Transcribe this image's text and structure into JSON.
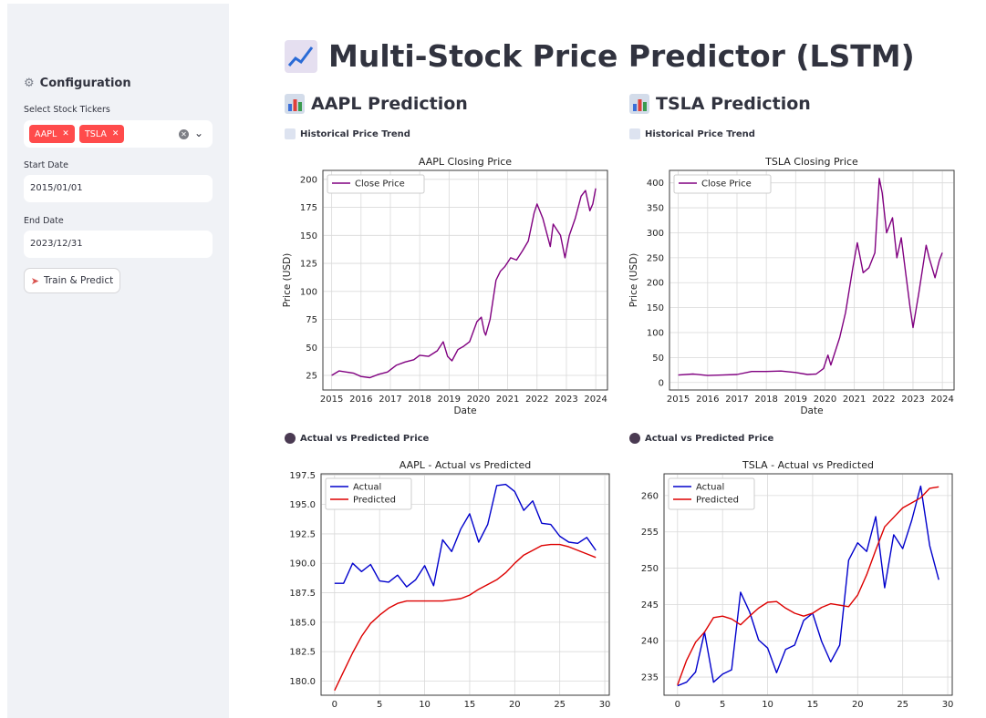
{
  "sidebar": {
    "title": "Configuration",
    "title_icon": "gear-icon",
    "tickers_label": "Select Stock Tickers",
    "tickers": [
      "AAPL",
      "TSLA"
    ],
    "start_label": "Start Date",
    "start_value": "2015/01/01",
    "end_label": "End Date",
    "end_value": "2023/12/31",
    "button_label": "Train & Predict",
    "button_icon": "rocket-icon"
  },
  "main": {
    "title": "Multi-Stock Price Predictor (LSTM)",
    "title_icon": "chart-increasing-icon",
    "columns": [
      {
        "title": "AAPL Prediction",
        "hist_label": "Historical Price Trend",
        "pred_label": "Actual vs Predicted Price"
      },
      {
        "title": "TSLA Prediction",
        "hist_label": "Historical Price Trend",
        "pred_label": "Actual vs Predicted Price"
      }
    ]
  },
  "colors": {
    "accent": "#ff4b4b",
    "sidebar_bg": "#f0f2f6",
    "close_line": "#800080",
    "actual_line": "#0000cc",
    "predicted_line": "#dd0000"
  },
  "chart_data": [
    {
      "type": "line",
      "title": "AAPL Closing Price",
      "xlabel": "Date",
      "ylabel": "Price (USD)",
      "legend": [
        "Close Price"
      ],
      "legend_position": "top-left",
      "grid": true,
      "xlim": [
        2014.7,
        2024.4
      ],
      "ylim": [
        12,
        208
      ],
      "xticks": [
        2015,
        2016,
        2017,
        2018,
        2019,
        2020,
        2021,
        2022,
        2023,
        2024
      ],
      "yticks": [
        25,
        50,
        75,
        100,
        125,
        150,
        175,
        200
      ],
      "series": [
        {
          "name": "Close Price",
          "color": "#800080",
          "x": [
            2015.0,
            2015.25,
            2015.5,
            2015.75,
            2016.0,
            2016.3,
            2016.6,
            2016.9,
            2017.2,
            2017.5,
            2017.8,
            2018.0,
            2018.3,
            2018.6,
            2018.8,
            2018.95,
            2019.1,
            2019.3,
            2019.5,
            2019.7,
            2019.95,
            2020.1,
            2020.2,
            2020.25,
            2020.4,
            2020.6,
            2020.75,
            2020.9,
            2021.1,
            2021.3,
            2021.5,
            2021.7,
            2021.9,
            2022.0,
            2022.2,
            2022.45,
            2022.55,
            2022.8,
            2022.95,
            2023.1,
            2023.3,
            2023.5,
            2023.65,
            2023.8,
            2023.9,
            2024.0
          ],
          "y": [
            25,
            29,
            28,
            27,
            24,
            23,
            26,
            28,
            34,
            37,
            39,
            43,
            42,
            47,
            55,
            42,
            38,
            48,
            51,
            55,
            73,
            77,
            64,
            61,
            75,
            110,
            118,
            122,
            130,
            128,
            136,
            145,
            170,
            178,
            165,
            140,
            160,
            150,
            130,
            150,
            165,
            185,
            190,
            172,
            178,
            192
          ]
        }
      ]
    },
    {
      "type": "line",
      "title": "TSLA Closing Price",
      "xlabel": "Date",
      "ylabel": "Price (USD)",
      "legend": [
        "Close Price"
      ],
      "legend_position": "top-left",
      "grid": true,
      "xlim": [
        2014.7,
        2024.4
      ],
      "ylim": [
        -15,
        425
      ],
      "xticks": [
        2015,
        2016,
        2017,
        2018,
        2019,
        2020,
        2021,
        2022,
        2023,
        2024
      ],
      "yticks": [
        0,
        50,
        100,
        150,
        200,
        250,
        300,
        350,
        400
      ],
      "series": [
        {
          "name": "Close Price",
          "color": "#800080",
          "x": [
            2015.0,
            2015.5,
            2016.0,
            2016.5,
            2017.0,
            2017.5,
            2018.0,
            2018.5,
            2019.0,
            2019.4,
            2019.7,
            2019.95,
            2020.1,
            2020.2,
            2020.5,
            2020.7,
            2020.95,
            2021.1,
            2021.3,
            2021.5,
            2021.7,
            2021.85,
            2021.95,
            2022.1,
            2022.3,
            2022.45,
            2022.6,
            2022.75,
            2022.9,
            2023.0,
            2023.2,
            2023.45,
            2023.55,
            2023.75,
            2023.9,
            2024.0
          ],
          "y": [
            15,
            17,
            14,
            15,
            16,
            22,
            22,
            23,
            20,
            16,
            17,
            28,
            55,
            35,
            90,
            140,
            230,
            280,
            220,
            230,
            260,
            409,
            380,
            300,
            330,
            250,
            290,
            220,
            150,
            110,
            180,
            275,
            250,
            210,
            245,
            260
          ]
        }
      ]
    },
    {
      "type": "line",
      "title": "AAPL - Actual vs Predicted",
      "legend": [
        "Actual",
        "Predicted"
      ],
      "legend_position": "top-left",
      "grid": true,
      "xlim": [
        -1.5,
        30.5
      ],
      "ylim": [
        178.8,
        197.6
      ],
      "xticks": [
        0,
        5,
        10,
        15,
        20,
        25,
        30
      ],
      "yticks": [
        180.0,
        182.5,
        185.0,
        187.5,
        190.0,
        192.5,
        195.0,
        197.5
      ],
      "series": [
        {
          "name": "Actual",
          "color": "#0000cc",
          "x": [
            0,
            1,
            2,
            3,
            4,
            5,
            6,
            7,
            8,
            9,
            10,
            11,
            12,
            13,
            14,
            15,
            16,
            17,
            18,
            19,
            20,
            21,
            22,
            23,
            24,
            25,
            26,
            27,
            28,
            29
          ],
          "y": [
            188.3,
            188.3,
            190.0,
            189.3,
            189.9,
            188.5,
            188.4,
            189.0,
            188.0,
            188.6,
            189.8,
            188.1,
            192.0,
            191.0,
            192.9,
            194.2,
            191.8,
            193.3,
            196.6,
            196.7,
            196.1,
            194.5,
            195.3,
            193.4,
            193.3,
            192.3,
            191.8,
            191.7,
            192.2,
            191.1
          ]
        },
        {
          "name": "Predicted",
          "color": "#dd0000",
          "x": [
            0,
            1,
            2,
            3,
            4,
            5,
            6,
            7,
            8,
            9,
            10,
            11,
            12,
            13,
            14,
            15,
            16,
            17,
            18,
            19,
            20,
            21,
            22,
            23,
            24,
            25,
            26,
            27,
            28,
            29
          ],
          "y": [
            179.2,
            180.8,
            182.4,
            183.8,
            184.9,
            185.6,
            186.2,
            186.6,
            186.8,
            186.8,
            186.8,
            186.8,
            186.8,
            186.9,
            187.0,
            187.3,
            187.8,
            188.2,
            188.6,
            189.2,
            190.0,
            190.7,
            191.1,
            191.5,
            191.6,
            191.6,
            191.4,
            191.1,
            190.8,
            190.5
          ]
        }
      ]
    },
    {
      "type": "line",
      "title": "TSLA - Actual vs Predicted",
      "legend": [
        "Actual",
        "Predicted"
      ],
      "legend_position": "top-left",
      "grid": true,
      "xlim": [
        -1.5,
        30.5
      ],
      "ylim": [
        232.5,
        263.0
      ],
      "xticks": [
        0,
        5,
        10,
        15,
        20,
        25,
        30
      ],
      "yticks": [
        235,
        240,
        245,
        250,
        255,
        260
      ],
      "series": [
        {
          "name": "Actual",
          "color": "#0000cc",
          "x": [
            0,
            1,
            2,
            3,
            4,
            5,
            6,
            7,
            8,
            9,
            10,
            11,
            12,
            13,
            14,
            15,
            16,
            17,
            18,
            19,
            20,
            21,
            22,
            23,
            24,
            25,
            26,
            27,
            28,
            29
          ],
          "y": [
            233.8,
            234.3,
            235.7,
            241.2,
            234.3,
            235.4,
            236.0,
            246.7,
            244.0,
            240.1,
            239.0,
            235.6,
            238.8,
            239.4,
            242.8,
            243.8,
            239.9,
            237.1,
            239.4,
            251.1,
            253.5,
            252.3,
            257.1,
            247.3,
            254.6,
            252.7,
            256.6,
            261.3,
            253.1,
            248.4
          ]
        },
        {
          "name": "Predicted",
          "color": "#dd0000",
          "x": [
            0,
            1,
            2,
            3,
            4,
            5,
            6,
            7,
            8,
            9,
            10,
            11,
            12,
            13,
            14,
            15,
            16,
            17,
            18,
            19,
            20,
            21,
            22,
            23,
            24,
            25,
            26,
            27,
            28,
            29
          ],
          "y": [
            233.9,
            237.3,
            239.8,
            241.2,
            243.2,
            243.4,
            243.0,
            242.2,
            243.4,
            244.5,
            245.3,
            245.4,
            244.5,
            243.8,
            243.4,
            243.8,
            244.6,
            245.1,
            244.9,
            244.7,
            246.3,
            249.1,
            252.5,
            255.7,
            257.0,
            258.3,
            259.0,
            259.7,
            261.0,
            261.2
          ]
        }
      ]
    }
  ]
}
